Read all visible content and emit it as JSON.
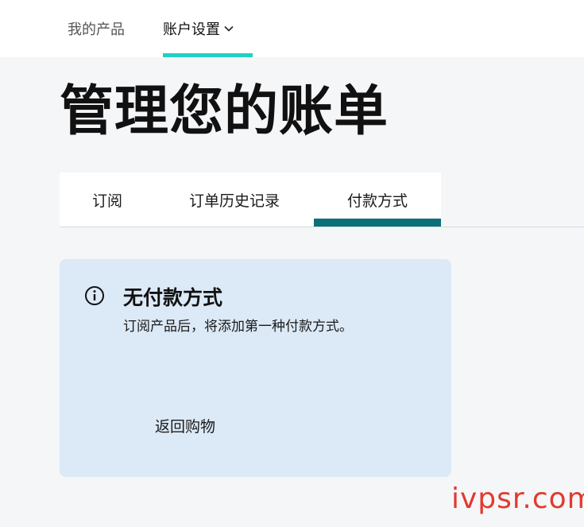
{
  "nav": {
    "products_label": "我的产品",
    "account_label": "账户设置",
    "account_chevron": "chevron-down-icon"
  },
  "page": {
    "title": "管理您的账单"
  },
  "tabs": [
    {
      "label": "订阅",
      "active": false
    },
    {
      "label": "订单历史记录",
      "active": false
    },
    {
      "label": "付款方式",
      "active": true
    }
  ],
  "notice": {
    "icon": "info-icon",
    "title": "无付款方式",
    "description": "订阅产品后，将添加第一种付款方式。",
    "link_label": "返回购物"
  },
  "watermark": "ivpsr.com",
  "colors": {
    "nav_accent": "#1fd1c4",
    "tab_accent": "#0c7078",
    "notice_bg": "#dce9f6",
    "page_bg": "#f5f6f8",
    "watermark": "#e23a2e"
  }
}
